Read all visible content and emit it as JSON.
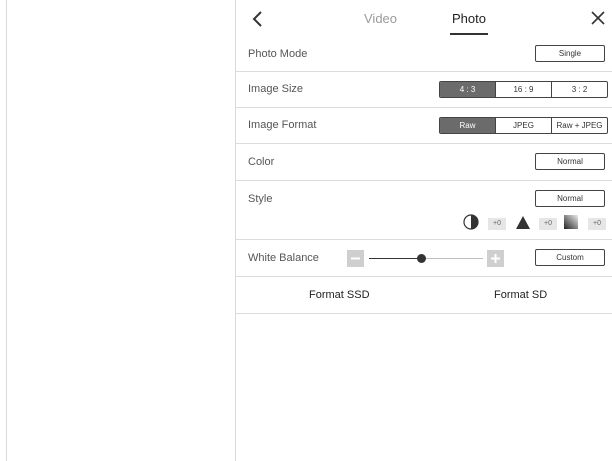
{
  "tabs": {
    "video": "Video",
    "photo": "Photo"
  },
  "rows": {
    "photo_mode": {
      "label": "Photo  Mode",
      "value": "Single"
    },
    "image_size": {
      "label": "Image  Size",
      "options": [
        "4 : 3",
        "16 : 9",
        "3 : 2"
      ],
      "selected": "4 : 3"
    },
    "image_format": {
      "label": "Image  Format",
      "options": [
        "Raw",
        "JPEG",
        "Raw + JPEG"
      ],
      "selected": "Raw"
    },
    "color": {
      "label": "Color",
      "value": "Normal"
    },
    "style": {
      "label": "Style",
      "value": "Normal",
      "adjustments": [
        {
          "icon": "contrast-icon",
          "value": "+0"
        },
        {
          "icon": "sharpness-icon",
          "value": "+0"
        },
        {
          "icon": "saturation-icon",
          "value": "+0"
        }
      ]
    },
    "white_balance": {
      "label": "White Balance",
      "value": "Custom",
      "slider_level": 0.4
    }
  },
  "actions": {
    "format_ssd": "Format SSD",
    "format_sd": "Format SD"
  },
  "colors": {
    "active_segment": "#6b6b6b",
    "border": "#444444",
    "divider": "#dcdcdc"
  }
}
